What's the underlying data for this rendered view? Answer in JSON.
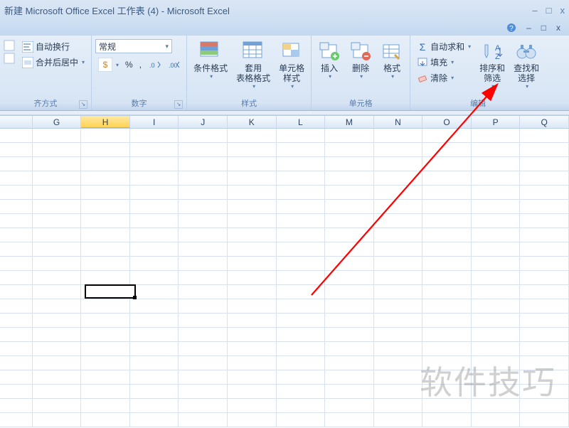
{
  "window": {
    "title": "新建 Microsoft Office Excel 工作表 (4) - Microsoft Excel",
    "controls": {
      "minimize": "–",
      "maximize": "□",
      "close": "x"
    }
  },
  "subctrl": {
    "help": "?",
    "min": "–",
    "restore": "□",
    "close": "x"
  },
  "ribbon": {
    "alignment": {
      "label": "齐方式",
      "wrap": "自动换行",
      "merge": "合并后居中"
    },
    "number": {
      "label": "数字",
      "format_select": "常规",
      "currency": "¥",
      "percent": "%",
      "comma": ",",
      "inc_dec": ".00",
      "dec_inc": ".0"
    },
    "styles": {
      "label": "样式",
      "cond_fmt": "条件格式",
      "fmt_table": "套用\n表格格式",
      "cell_styles": "单元格\n样式"
    },
    "cells": {
      "label": "单元格",
      "insert": "插入",
      "delete": "删除",
      "format": "格式"
    },
    "editing": {
      "label": "编辑",
      "autosum": "自动求和",
      "fill": "填充",
      "clear": "清除",
      "sort_filter": "排序和\n筛选",
      "find_select": "查找和\n选择"
    }
  },
  "columns": [
    "G",
    "H",
    "I",
    "J",
    "K",
    "L",
    "M",
    "N",
    "O",
    "P",
    "Q"
  ],
  "selected_column_index": 1,
  "active_cell": {
    "col": 1,
    "row": 11
  },
  "watermark": "软件技巧"
}
